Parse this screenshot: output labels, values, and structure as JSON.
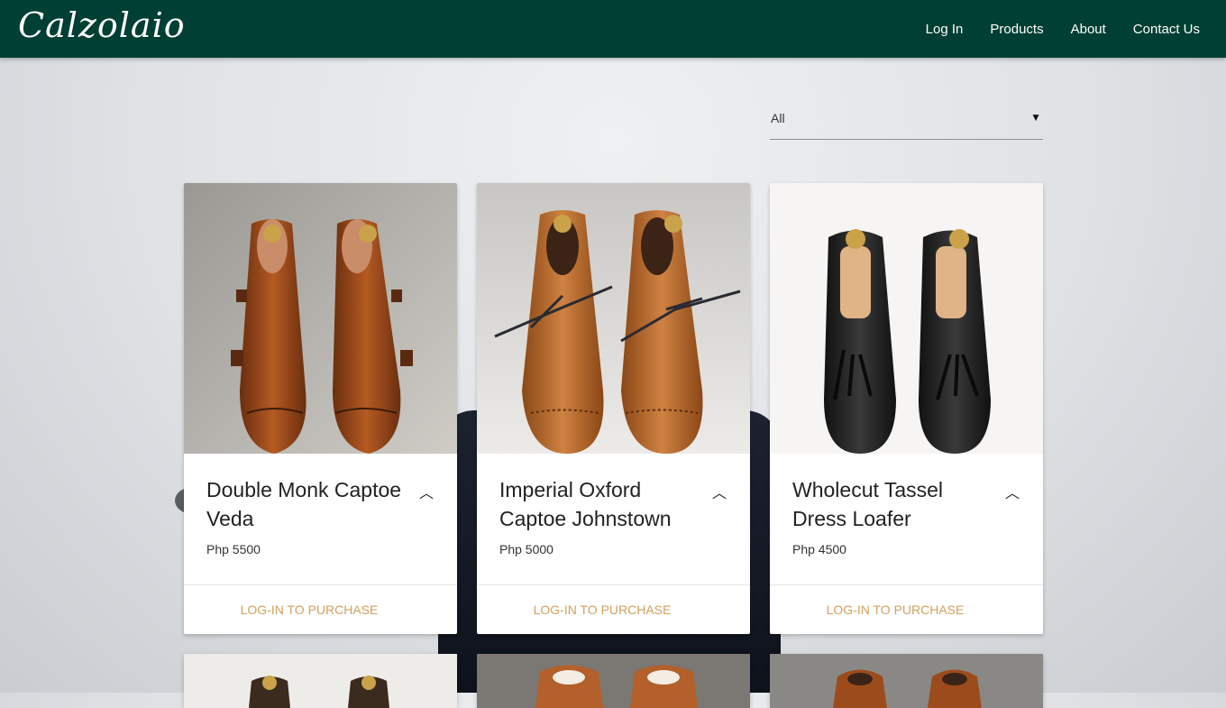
{
  "brand": {
    "name": "Calzolaio"
  },
  "nav": {
    "items": [
      {
        "label": "Log In"
      },
      {
        "label": "Products"
      },
      {
        "label": "About"
      },
      {
        "label": "Contact Us"
      }
    ]
  },
  "filter": {
    "selected": "All",
    "arrow_icon": "dropdown-caret-icon"
  },
  "products": [
    {
      "name": "Double Monk Captoe Veda",
      "price": "Php 5500",
      "action": "Log-in to purchase",
      "image": "brown double monk strap shoes"
    },
    {
      "name": "Imperial Oxford Captoe Johnstown",
      "price": "Php 5000",
      "action": "Log-in to purchase",
      "image": "brown lace-up oxford shoes"
    },
    {
      "name": "Wholecut Tassel Dress Loafer",
      "price": "Php 4500",
      "action": "Log-in to purchase",
      "image": "black tassel loafers"
    }
  ],
  "colors": {
    "navbar": "#003f33",
    "action_text": "#d4a05e"
  }
}
